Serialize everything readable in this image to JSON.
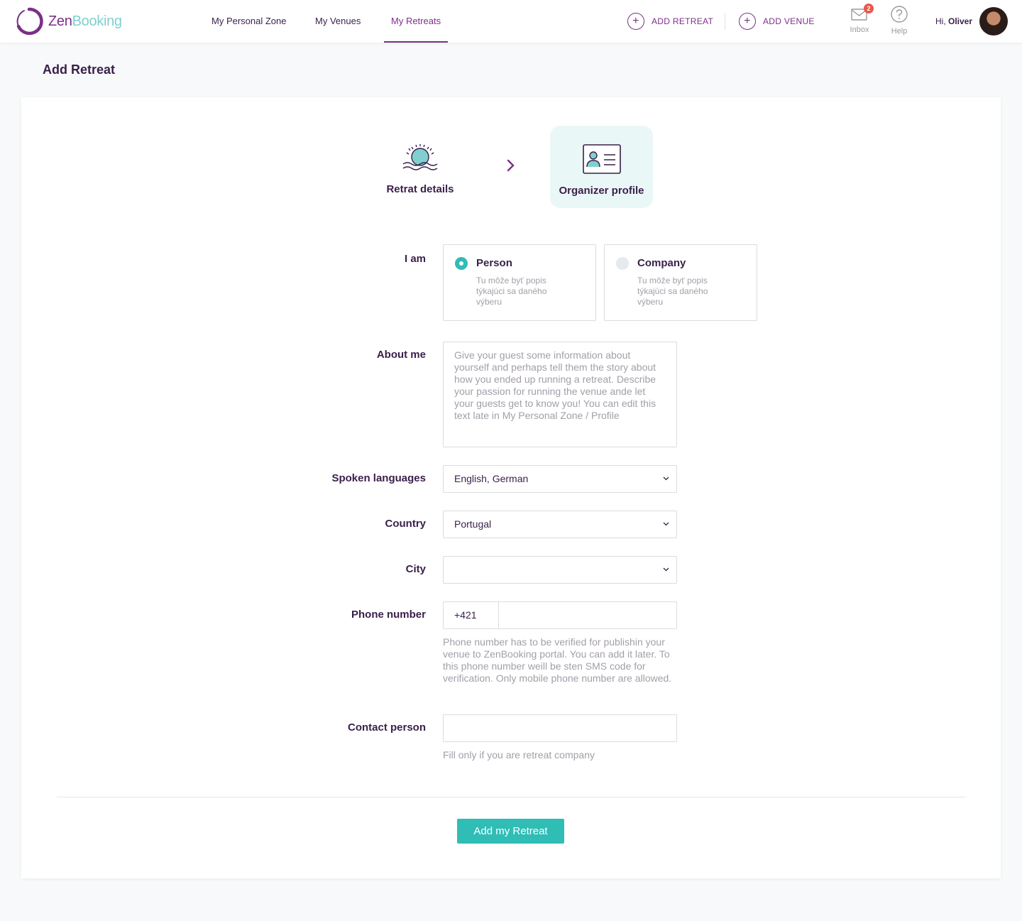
{
  "brand": {
    "name_part1": "Zen",
    "name_part2": "Booking"
  },
  "nav": {
    "links": [
      {
        "label": "My Personal Zone"
      },
      {
        "label": "My Venues"
      },
      {
        "label": "My Retreats"
      }
    ],
    "add_retreat": "ADD RETREAT",
    "add_venue": "ADD VENUE",
    "inbox_label": "Inbox",
    "inbox_count": "2",
    "help_label": "Help",
    "greeting_prefix": "Hi, ",
    "user_name": "Oliver"
  },
  "page": {
    "title": "Add Retreat"
  },
  "steps": [
    {
      "label": "Retrat details",
      "icon": "sunrise-icon"
    },
    {
      "label": "Organizer profile",
      "icon": "id-card-icon",
      "active": true
    }
  ],
  "form": {
    "iam": {
      "label": "I am",
      "options": [
        {
          "title": "Person",
          "desc": "Tu môže byť popis týkajúci sa daného výberu",
          "selected": true
        },
        {
          "title": "Company",
          "desc": "Tu môže byť popis týkajúci sa daného výberu",
          "selected": false
        }
      ]
    },
    "about": {
      "label": "About me",
      "placeholder": "Give your guest some information about yourself and perhaps tell them the story about how you ended up running a retreat. Describe your passion for running the venue ande let your guests get to know you! You can edit this text late in My Personal Zone / Profile"
    },
    "languages": {
      "label": "Spoken languages",
      "value": "English, German"
    },
    "country": {
      "label": "Country",
      "value": "Portugal"
    },
    "city": {
      "label": "City",
      "value": ""
    },
    "phone": {
      "label": "Phone number",
      "prefix": "+421",
      "value": "",
      "hint": "Phone number has to be verified for publishin your venue to ZenBooking portal. You can add it later. To this phone number weill be sten SMS code for verification. Only mobile phone number are allowed."
    },
    "contact": {
      "label": "Contact person",
      "value": "",
      "hint": "Fill only if you are retreat company"
    },
    "submit_label": "Add my Retreat"
  },
  "colors": {
    "brand_purple": "#7b2f87",
    "brand_teal": "#2fbdb6",
    "text_dark": "#3a1f4a",
    "muted": "#a39ea8"
  }
}
